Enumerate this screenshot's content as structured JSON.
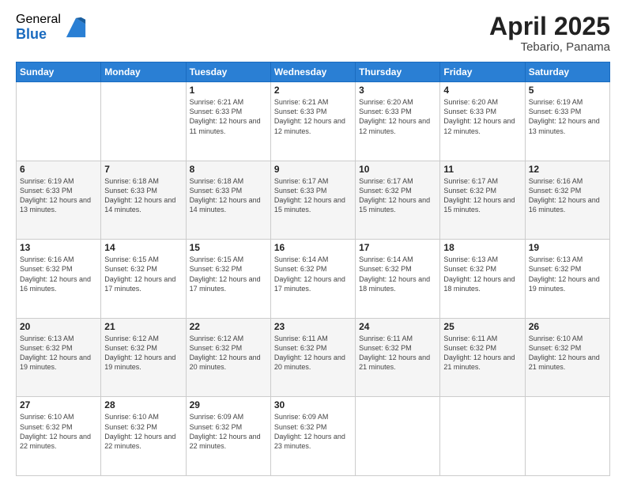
{
  "header": {
    "logo_general": "General",
    "logo_blue": "Blue",
    "month_year": "April 2025",
    "location": "Tebario, Panama"
  },
  "days_of_week": [
    "Sunday",
    "Monday",
    "Tuesday",
    "Wednesday",
    "Thursday",
    "Friday",
    "Saturday"
  ],
  "weeks": [
    [
      {
        "day": "",
        "info": ""
      },
      {
        "day": "",
        "info": ""
      },
      {
        "day": "1",
        "info": "Sunrise: 6:21 AM\nSunset: 6:33 PM\nDaylight: 12 hours and 11 minutes."
      },
      {
        "day": "2",
        "info": "Sunrise: 6:21 AM\nSunset: 6:33 PM\nDaylight: 12 hours and 12 minutes."
      },
      {
        "day": "3",
        "info": "Sunrise: 6:20 AM\nSunset: 6:33 PM\nDaylight: 12 hours and 12 minutes."
      },
      {
        "day": "4",
        "info": "Sunrise: 6:20 AM\nSunset: 6:33 PM\nDaylight: 12 hours and 12 minutes."
      },
      {
        "day": "5",
        "info": "Sunrise: 6:19 AM\nSunset: 6:33 PM\nDaylight: 12 hours and 13 minutes."
      }
    ],
    [
      {
        "day": "6",
        "info": "Sunrise: 6:19 AM\nSunset: 6:33 PM\nDaylight: 12 hours and 13 minutes."
      },
      {
        "day": "7",
        "info": "Sunrise: 6:18 AM\nSunset: 6:33 PM\nDaylight: 12 hours and 14 minutes."
      },
      {
        "day": "8",
        "info": "Sunrise: 6:18 AM\nSunset: 6:33 PM\nDaylight: 12 hours and 14 minutes."
      },
      {
        "day": "9",
        "info": "Sunrise: 6:17 AM\nSunset: 6:33 PM\nDaylight: 12 hours and 15 minutes."
      },
      {
        "day": "10",
        "info": "Sunrise: 6:17 AM\nSunset: 6:32 PM\nDaylight: 12 hours and 15 minutes."
      },
      {
        "day": "11",
        "info": "Sunrise: 6:17 AM\nSunset: 6:32 PM\nDaylight: 12 hours and 15 minutes."
      },
      {
        "day": "12",
        "info": "Sunrise: 6:16 AM\nSunset: 6:32 PM\nDaylight: 12 hours and 16 minutes."
      }
    ],
    [
      {
        "day": "13",
        "info": "Sunrise: 6:16 AM\nSunset: 6:32 PM\nDaylight: 12 hours and 16 minutes."
      },
      {
        "day": "14",
        "info": "Sunrise: 6:15 AM\nSunset: 6:32 PM\nDaylight: 12 hours and 17 minutes."
      },
      {
        "day": "15",
        "info": "Sunrise: 6:15 AM\nSunset: 6:32 PM\nDaylight: 12 hours and 17 minutes."
      },
      {
        "day": "16",
        "info": "Sunrise: 6:14 AM\nSunset: 6:32 PM\nDaylight: 12 hours and 17 minutes."
      },
      {
        "day": "17",
        "info": "Sunrise: 6:14 AM\nSunset: 6:32 PM\nDaylight: 12 hours and 18 minutes."
      },
      {
        "day": "18",
        "info": "Sunrise: 6:13 AM\nSunset: 6:32 PM\nDaylight: 12 hours and 18 minutes."
      },
      {
        "day": "19",
        "info": "Sunrise: 6:13 AM\nSunset: 6:32 PM\nDaylight: 12 hours and 19 minutes."
      }
    ],
    [
      {
        "day": "20",
        "info": "Sunrise: 6:13 AM\nSunset: 6:32 PM\nDaylight: 12 hours and 19 minutes."
      },
      {
        "day": "21",
        "info": "Sunrise: 6:12 AM\nSunset: 6:32 PM\nDaylight: 12 hours and 19 minutes."
      },
      {
        "day": "22",
        "info": "Sunrise: 6:12 AM\nSunset: 6:32 PM\nDaylight: 12 hours and 20 minutes."
      },
      {
        "day": "23",
        "info": "Sunrise: 6:11 AM\nSunset: 6:32 PM\nDaylight: 12 hours and 20 minutes."
      },
      {
        "day": "24",
        "info": "Sunrise: 6:11 AM\nSunset: 6:32 PM\nDaylight: 12 hours and 21 minutes."
      },
      {
        "day": "25",
        "info": "Sunrise: 6:11 AM\nSunset: 6:32 PM\nDaylight: 12 hours and 21 minutes."
      },
      {
        "day": "26",
        "info": "Sunrise: 6:10 AM\nSunset: 6:32 PM\nDaylight: 12 hours and 21 minutes."
      }
    ],
    [
      {
        "day": "27",
        "info": "Sunrise: 6:10 AM\nSunset: 6:32 PM\nDaylight: 12 hours and 22 minutes."
      },
      {
        "day": "28",
        "info": "Sunrise: 6:10 AM\nSunset: 6:32 PM\nDaylight: 12 hours and 22 minutes."
      },
      {
        "day": "29",
        "info": "Sunrise: 6:09 AM\nSunset: 6:32 PM\nDaylight: 12 hours and 22 minutes."
      },
      {
        "day": "30",
        "info": "Sunrise: 6:09 AM\nSunset: 6:32 PM\nDaylight: 12 hours and 23 minutes."
      },
      {
        "day": "",
        "info": ""
      },
      {
        "day": "",
        "info": ""
      },
      {
        "day": "",
        "info": ""
      }
    ]
  ]
}
